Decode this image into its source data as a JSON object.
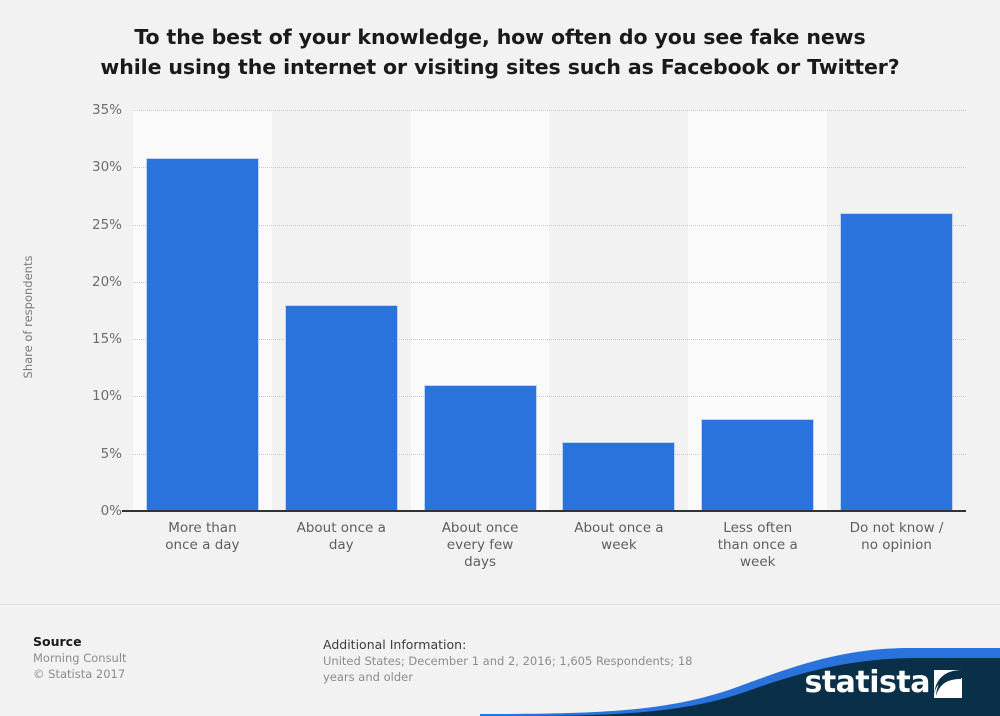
{
  "title": {
    "line1": "To the best of your knowledge, how often do you see fake news",
    "line2": "while using the internet or visiting sites such as Facebook or Twitter?"
  },
  "footer": {
    "source_head": "Source",
    "source_name": "Morning Consult",
    "copyright": "© Statista 2017",
    "info_head": "Additional Information:",
    "info_line1": "United States; December 1 and 2, 2016; 1,605 Respondents; 18",
    "info_line2": "years and older",
    "logo_text": "statista"
  },
  "colors": {
    "bar": "#2b73dc",
    "bar_border": "#c3d4f0",
    "background": "#f2f2f2",
    "band": "#fafafa",
    "gridline": "#c9c9c9",
    "axis": "#333333",
    "logo_navy": "#0a3049",
    "logo_blue": "#2b73dc",
    "title_text": "#1a1a1a",
    "tick_text": "#6d6d6d"
  },
  "chart_data": {
    "type": "bar",
    "title": "To the best of your knowledge, how often do you see fake news while using the internet or visiting sites such as Facebook or Twitter?",
    "xlabel": "",
    "ylabel": "Share of respondents",
    "categories": [
      "More than once a day",
      "About once a day",
      "About once every few days",
      "About once a week",
      "Less often than once a week",
      "Do not know / no opinion"
    ],
    "category_lines": [
      [
        "More than",
        "once a day"
      ],
      [
        "About once a",
        "day"
      ],
      [
        "About once",
        "every few",
        "days"
      ],
      [
        "About once a",
        "week"
      ],
      [
        "Less often",
        "than once a",
        "week"
      ],
      [
        "Do not know /",
        "no opinion"
      ]
    ],
    "values": [
      30.8,
      18.0,
      11.0,
      6.0,
      8.0,
      26.0
    ],
    "ylim": [
      0,
      35
    ],
    "ytick_values": [
      35,
      30,
      25,
      20,
      15,
      10,
      5,
      0
    ],
    "ytick_labels": [
      "35%",
      "30%",
      "25%",
      "20%",
      "15%",
      "10%",
      "5%",
      "0%"
    ],
    "grid": true,
    "legend": false
  }
}
